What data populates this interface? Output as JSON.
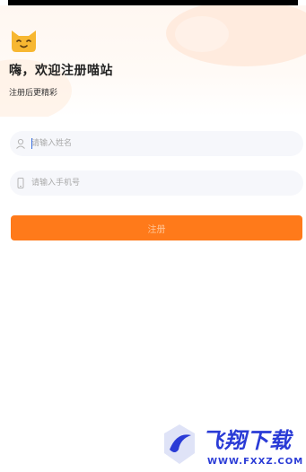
{
  "header": {
    "title": "嗨，欢迎注册喵站",
    "subtitle": "注册后更精彩"
  },
  "form": {
    "name_placeholder": "请输入姓名",
    "phone_placeholder": "请输入手机号",
    "submit_label": "注册"
  },
  "icons": {
    "logo": "cat-logo-icon",
    "name": "user-icon",
    "phone": "phone-icon"
  },
  "colors": {
    "accent": "#ff7a1a",
    "button_text": "#ffc597",
    "watermark": "#2a3bd6"
  },
  "watermark": {
    "brand": "飞翔下载",
    "url": "WWW.FXXZ.COM"
  }
}
